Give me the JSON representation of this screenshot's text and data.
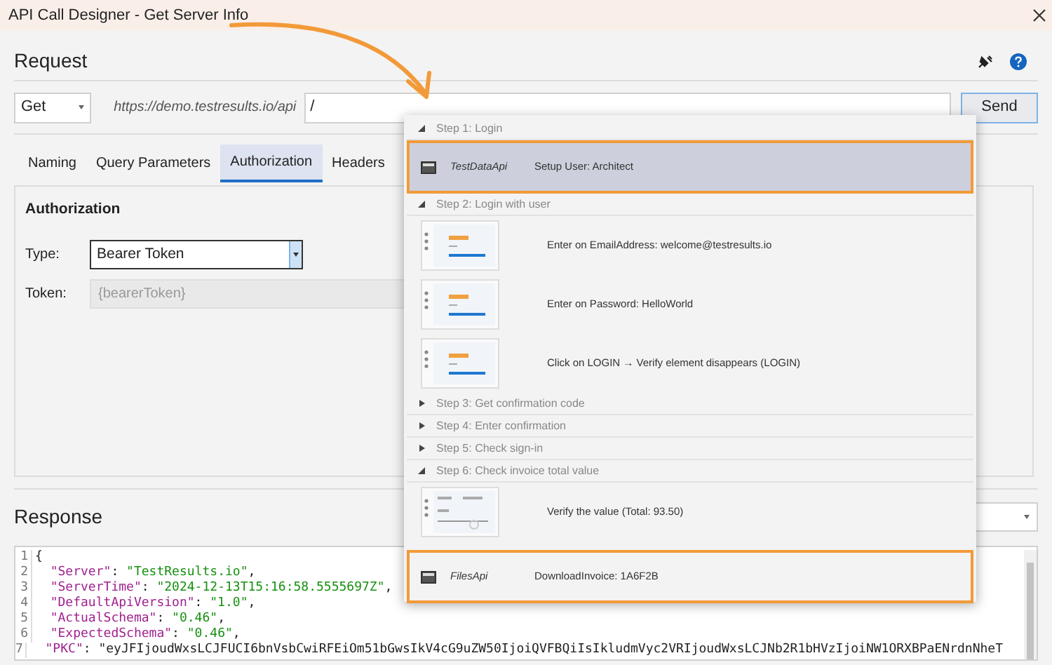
{
  "window": {
    "title": "API Call Designer - Get Server Info"
  },
  "request": {
    "heading": "Request",
    "method": "Get",
    "base_url": "https://demo.testresults.io/api",
    "path": "/",
    "send": "Send"
  },
  "tabs": [
    {
      "label": "Naming",
      "selected": false
    },
    {
      "label": "Query Parameters",
      "selected": false
    },
    {
      "label": "Authorization",
      "selected": true
    },
    {
      "label": "Headers",
      "selected": false
    }
  ],
  "authorization": {
    "heading": "Authorization",
    "type_label": "Type:",
    "type_value": "Bearer Token",
    "token_label": "Token:",
    "token_value": "{bearerToken}",
    "token_disabled": true
  },
  "response": {
    "heading": "Response",
    "code_lines": [
      {
        "number": "1",
        "text": "{"
      },
      {
        "number": "2",
        "text": "  \"Server\": \"TestResults.io\","
      },
      {
        "number": "3",
        "text": "  \"ServerTime\": \"2024-12-13T15:16:58.5555697Z\","
      },
      {
        "number": "4",
        "text": "  \"DefaultApiVersion\": \"1.0\","
      },
      {
        "number": "5",
        "text": "  \"ActualSchema\": \"0.46\","
      },
      {
        "number": "6",
        "text": "  \"ExpectedSchema\": \"0.46\","
      },
      {
        "number": "7",
        "text": "  \"PKC\": \"eyJFIjoudWxsLCJFUCI6bnVsbCwiRFEiOm51bGwsIkV4cG9uZW50IjoiQVFBQiIsIkludmVyc2VRIjoudWxsLCJNb2R1bHVzIjoiNW1ORXBPaENrdnNheT"
      }
    ]
  },
  "suggestions": {
    "items": [
      {
        "kind": "step",
        "label": "Step 1: Login",
        "expanded": true,
        "children": [
          {
            "kind": "api",
            "name": "TestDataApi",
            "text": "Setup User: Architect",
            "selected": true,
            "highlighted": true
          }
        ]
      },
      {
        "kind": "step",
        "label": "Step 2: Login with user",
        "expanded": true,
        "children": [
          {
            "kind": "screenshot",
            "text": "Enter on EmailAddress: welcome@testresults.io",
            "chart": false
          },
          {
            "kind": "screenshot",
            "text": "Enter on Password: HelloWorld",
            "chart": false
          },
          {
            "kind": "screenshot",
            "text": "Click on LOGIN → Verify element disappears (LOGIN)",
            "chart": false
          }
        ]
      },
      {
        "kind": "step",
        "label": "Step 3: Get confirmation code",
        "expanded": false
      },
      {
        "kind": "step",
        "label": "Step 4: Enter confirmation",
        "expanded": false
      },
      {
        "kind": "step",
        "label": "Step 5: Check sign-in",
        "expanded": false
      },
      {
        "kind": "step",
        "label": "Step 6: Check invoice total value",
        "expanded": true,
        "children": [
          {
            "kind": "screenshot",
            "text": "Verify the value (Total: 93.50)",
            "chart": true
          }
        ]
      },
      {
        "kind": "api",
        "name": "FilesApi",
        "text": "DownloadInvoice: 1A6F2B",
        "selected": false,
        "highlighted": true
      }
    ]
  }
}
